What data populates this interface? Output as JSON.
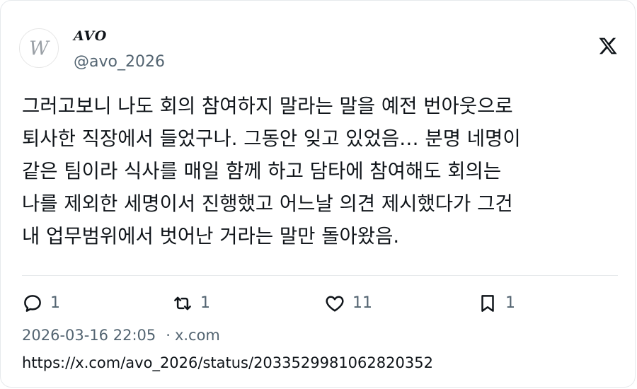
{
  "author": {
    "display_name": "AVO",
    "handle": "@avo_2026",
    "avatar_letter": "W"
  },
  "icons": {
    "platform": "x-logo-icon",
    "reply": "speech-bubble-icon",
    "retweet": "retweet-arrows-icon",
    "like": "heart-outline-icon",
    "bookmark": "bookmark-outline-icon"
  },
  "tweet": {
    "text": "그러고보니 나도 회의 참여하지 말라는 말을 예전 번아웃으로\n퇴사한 직장에서 들었구나. 그동안 잊고 있었음… 분명 네명이\n같은 팀이라 식사를 매일 함께 하고 담타에 참여해도 회의는\n나를 제외한 세명이서 진행했고 어느날 의견 제시했다가 그건\n내 업무범위에서 벗어난 거라는 말만 돌아왔음."
  },
  "stats": {
    "replies": "1",
    "retweets": "1",
    "likes": "11",
    "bookmarks": "1"
  },
  "meta": {
    "timestamp": "2026-03-16 22:05",
    "separator": "·",
    "source": "x.com",
    "url": "https://x.com/avo_2026/status/2033529981062820352"
  },
  "colors": {
    "text": "#0f1419",
    "secondary": "#536471",
    "border": "#e6e9ec"
  }
}
